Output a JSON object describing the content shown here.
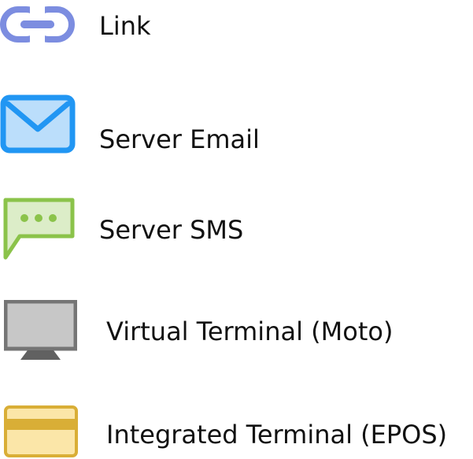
{
  "items": [
    {
      "label": "Link",
      "icon": "link-icon",
      "color": "#7c8de0"
    },
    {
      "label": "Server Email",
      "icon": "envelope-icon",
      "color": "#2196f3"
    },
    {
      "label": "Server SMS",
      "icon": "chat-bubble-icon",
      "color": "#8bc34a"
    },
    {
      "label": "Virtual Terminal (Moto)",
      "icon": "monitor-icon",
      "color": "#757575"
    },
    {
      "label": "Integrated Terminal (EPOS)",
      "icon": "card-icon",
      "color": "#d9ae36"
    }
  ]
}
